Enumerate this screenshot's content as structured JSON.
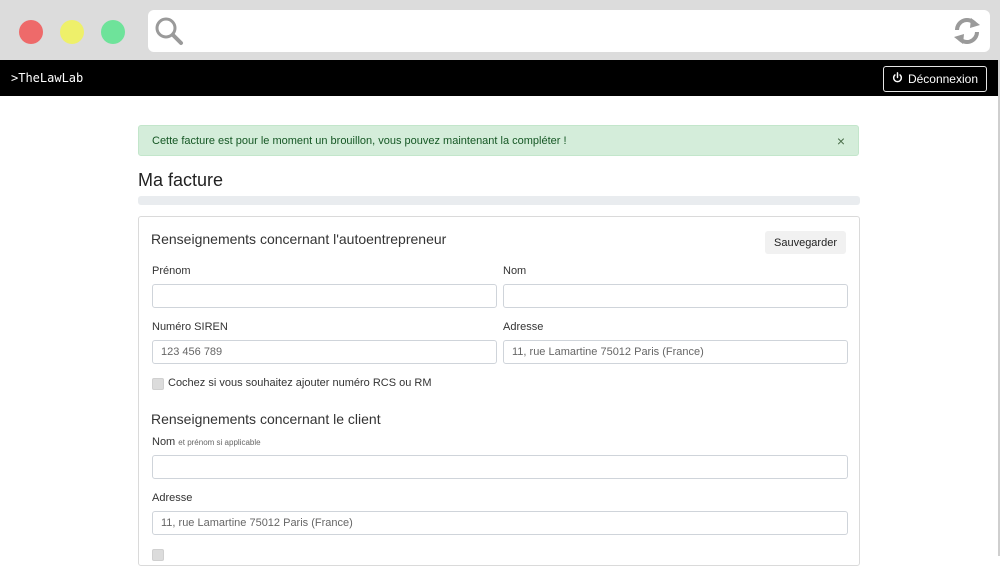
{
  "navbar": {
    "brand": ">TheLawLab",
    "logout_label": "Déconnexion"
  },
  "alert": {
    "text": "Cette facture est pour le moment un brouillon, vous pouvez maintenant la compléter !",
    "close": "×"
  },
  "page": {
    "title": "Ma facture",
    "progress_percent": 0,
    "progress_label": "0%"
  },
  "card": {
    "section1_title": "Renseignements concernant l'autoentrepreneur",
    "save_label": "Sauvegarder",
    "prenom_label": "Prénom",
    "prenom_value": "",
    "nom_label": "Nom",
    "nom_value": "",
    "siren_label": "Numéro SIREN",
    "siren_placeholder": "123 456 789",
    "adresse_label": "Adresse",
    "adresse_placeholder": "11, rue Lamartine 75012 Paris (France)",
    "rcs_label": "Cochez si vous souhaitez ajouter numéro RCS ou RM",
    "section2_title": "Renseignements concernant le client",
    "client_nom_label": "Nom",
    "client_nom_hint": "et prénom si applicable",
    "client_nom_value": "",
    "client_adresse_label": "Adresse",
    "client_adresse_placeholder": "11, rue Lamartine 75012 Paris (France)"
  }
}
